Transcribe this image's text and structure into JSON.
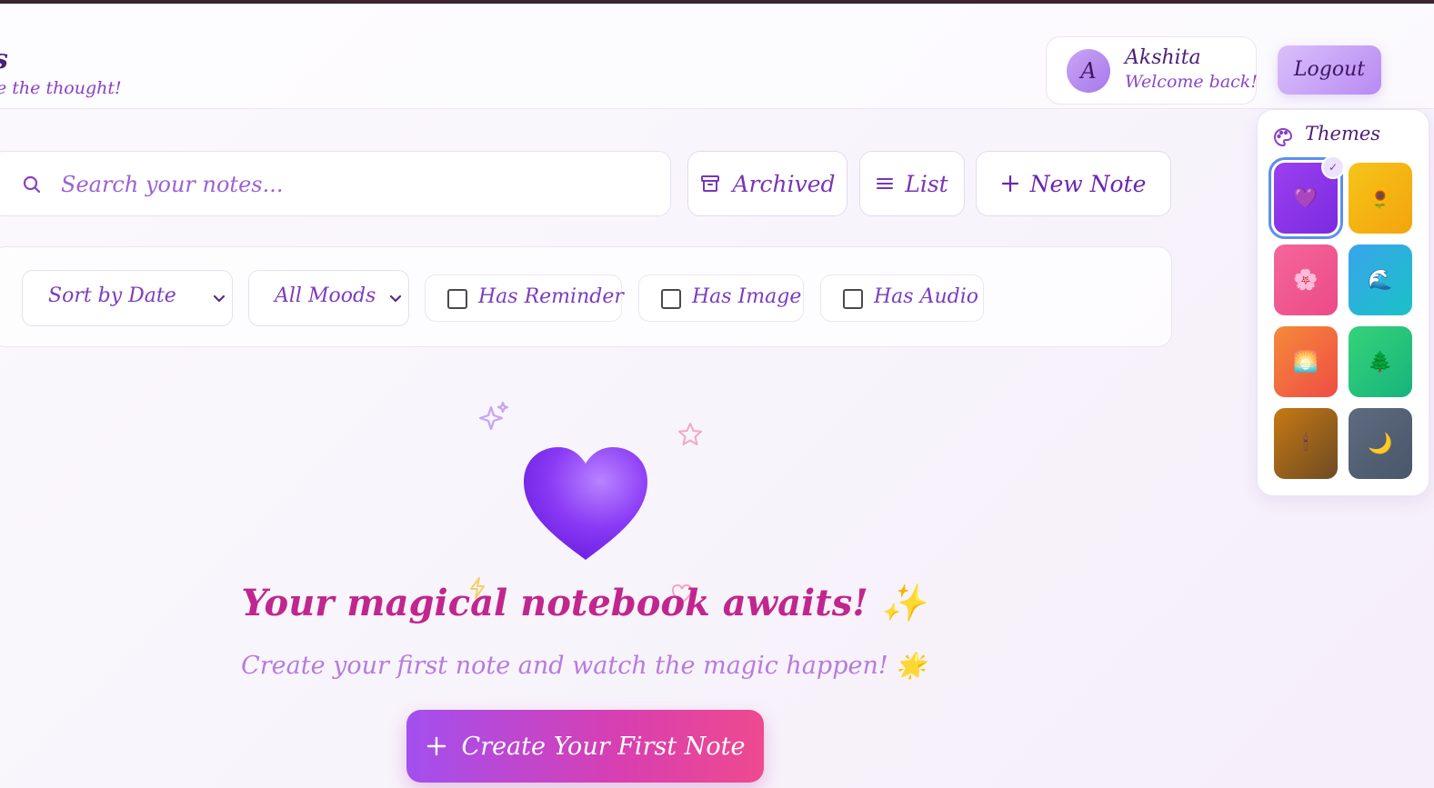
{
  "header": {
    "brand_title": "s",
    "brand_subtitle": "e the thought!",
    "user": {
      "initial": "A",
      "name": "Akshita",
      "welcome": "Welcome back!"
    },
    "logout_label": "Logout"
  },
  "toolbar": {
    "search_placeholder": "Search your notes...",
    "archived_label": "Archived",
    "list_label": "List",
    "new_note_label": "New Note"
  },
  "filters": {
    "sort_selected": "Sort by Date",
    "mood_selected": "All Moods",
    "has_reminder_label": "Has Reminder",
    "has_reminder_checked": false,
    "has_image_label": "Has Image",
    "has_image_checked": false,
    "has_audio_label": "Has Audio",
    "has_audio_checked": false
  },
  "themes": {
    "title": "Themes",
    "selected_index": 0,
    "swatches": [
      {
        "icon": "💜",
        "colors": [
          "#9b40f0",
          "#7b2be0"
        ]
      },
      {
        "icon": "🌻",
        "colors": [
          "#f6c419",
          "#f3a40e"
        ]
      },
      {
        "icon": "🌸",
        "colors": [
          "#f4669a",
          "#ec4a88"
        ]
      },
      {
        "icon": "🌊",
        "colors": [
          "#39a4ec",
          "#1ac2c6"
        ]
      },
      {
        "icon": "🌅",
        "colors": [
          "#f58a3a",
          "#ef4c44"
        ]
      },
      {
        "icon": "🌲",
        "colors": [
          "#36d27a",
          "#16b47c"
        ]
      },
      {
        "icon": "🕯",
        "colors": [
          "#c67a12",
          "#6e4a24"
        ]
      },
      {
        "icon": "🌙",
        "colors": [
          "#5d6b80",
          "#4a5669"
        ]
      }
    ]
  },
  "empty_state": {
    "title": "Your magical notebook awaits! ✨",
    "subtitle": "Create your first note and watch the magic happen! 🌟",
    "cta_label": "Create Your First Note"
  },
  "colors": {
    "accent": "#7a35b8",
    "title_pink": "#c0268e",
    "cta_gradient": [
      "#a34ff0",
      "#ee4a8f"
    ]
  }
}
